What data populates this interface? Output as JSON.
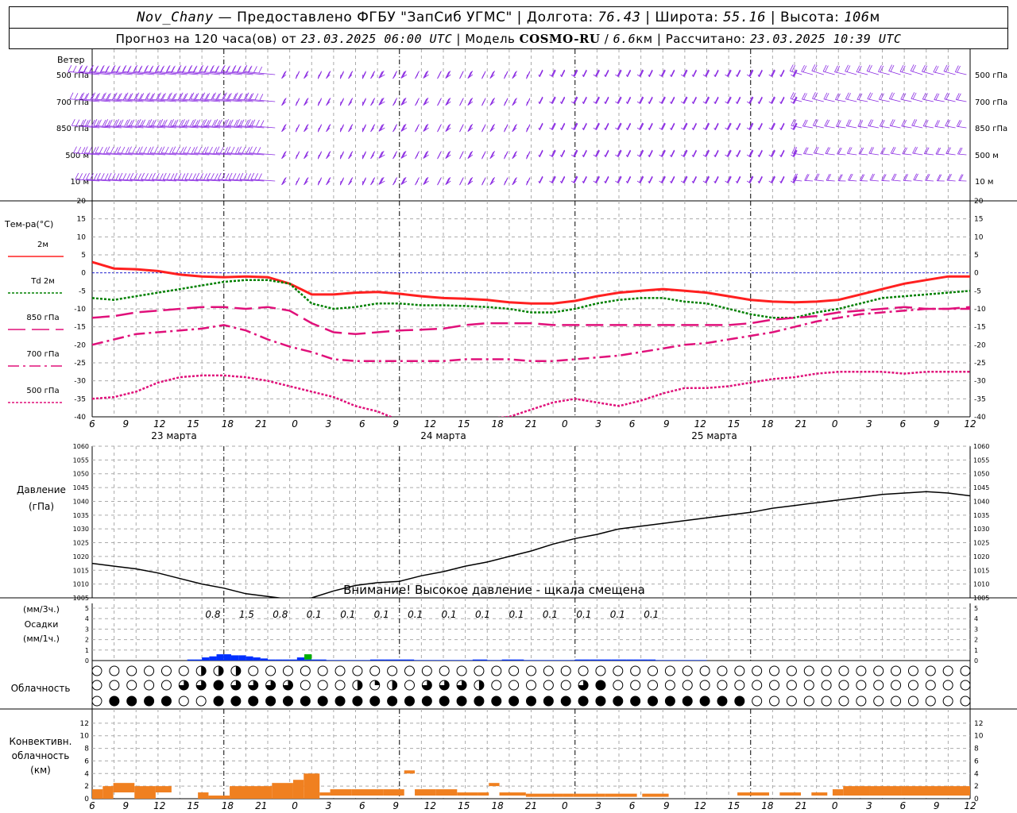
{
  "header": {
    "station": "Nov_Chany",
    "provider": "Предоставлено ФГБУ \"ЗапСиб УГМС\"",
    "lon_label": "Долгота:",
    "lon": "76.43",
    "lat_label": "Широта:",
    "lat": "55.16",
    "alt_label": "Высота:",
    "alt": "106",
    "alt_unit": "м",
    "forecast_label": "Прогноз на 120 часа(ов) от",
    "forecast_start": "23.03.2025 06:00 UTC",
    "model_label": "Модель",
    "model": "COSMO-RU",
    "model_res": "6.6",
    "model_res_unit": "км",
    "calc_label": "Рассчитано:",
    "calc_time": "23.03.2025 10:39 UTC"
  },
  "colors": {
    "wind": "#8a2be2",
    "t2m": "#ff2020",
    "td2m": "#008000",
    "t850": "#e0107a",
    "t700": "#e0107a",
    "t500": "#e0107a",
    "zero_line": "#0000cc",
    "pressure": "#000000",
    "precip3": "#0030ff",
    "precip_green": "#00b000",
    "convective": "#f08020",
    "grid": "#aaaaaa"
  },
  "chart_data": [
    {
      "type": "line",
      "panel": "temperature",
      "ylabel": "Тем-ра(°C)",
      "ylim": [
        -40,
        20
      ],
      "yticks": [
        20,
        15,
        10,
        5,
        0,
        -5,
        -10,
        -15,
        -20,
        -25,
        -30,
        -35,
        -40
      ],
      "x_hours": [
        0,
        3,
        6,
        9,
        12,
        15,
        18,
        21,
        24,
        27,
        30,
        33,
        36,
        39,
        42,
        45,
        48,
        51,
        54,
        57,
        60,
        63,
        66,
        69,
        72,
        75,
        78,
        81,
        84,
        87,
        90,
        93,
        96,
        99,
        102,
        105,
        108,
        111,
        114,
        117,
        120
      ],
      "xtick_labels": [
        "6",
        "9",
        "12",
        "15",
        "18",
        "21",
        "0",
        "3",
        "6",
        "9",
        "12",
        "15",
        "18",
        "21",
        "0",
        "3",
        "6",
        "9",
        "12",
        "15",
        "18",
        "21",
        "0",
        "3",
        "6",
        "9",
        "12"
      ],
      "date_labels": [
        "23 марта",
        "24 марта",
        "25 марта"
      ],
      "series": [
        {
          "name": "2м",
          "style": "solid",
          "values": [
            3,
            1.2,
            1,
            0.5,
            -0.5,
            -1,
            -1.2,
            -1,
            -1.2,
            -3,
            -6,
            -6,
            -5.5,
            -5.3,
            -5.8,
            -6.5,
            -7,
            -7.2,
            -7.5,
            -8.2,
            -8.5,
            -8.5,
            -7.8,
            -6.5,
            -5.5,
            -5,
            -4.5,
            -5,
            -5.5,
            -6.5,
            -7.5,
            -8,
            -8.2,
            -8,
            -7.5,
            -6,
            -4.5,
            -3,
            -2,
            -1,
            -1
          ]
        },
        {
          "name": "Td 2м",
          "style": "dotted",
          "values": [
            -7,
            -7.5,
            -6.5,
            -5.5,
            -4.5,
            -3.5,
            -2.5,
            -2,
            -2,
            -3,
            -8.5,
            -10,
            -9.5,
            -8.5,
            -8.5,
            -9,
            -9,
            -9.2,
            -9.5,
            -10,
            -11,
            -11,
            -10,
            -8.5,
            -7.5,
            -7,
            -7,
            -8,
            -8.5,
            -10,
            -11.5,
            -12.5,
            -12.5,
            -11,
            -10,
            -8.5,
            -7,
            -6.5,
            -6,
            -5.5,
            -5
          ]
        },
        {
          "name": "850 гПа",
          "style": "longdash",
          "values": [
            -12.5,
            -12,
            -11,
            -10.5,
            -10,
            -9.5,
            -9.5,
            -10,
            -9.5,
            -10.5,
            -14,
            -16.5,
            -17,
            -16.5,
            -16,
            -15.8,
            -15.5,
            -14.5,
            -14,
            -14,
            -14,
            -14.5,
            -14.5,
            -14.5,
            -14.5,
            -14.5,
            -14.5,
            -14.5,
            -14.5,
            -14.5,
            -14,
            -13,
            -12.5,
            -12,
            -11,
            -10.5,
            -10,
            -9.5,
            -10,
            -10,
            -9.5
          ]
        },
        {
          "name": "700 гПа",
          "style": "dashdot",
          "values": [
            -20,
            -18.5,
            -17,
            -16.5,
            -16,
            -15.5,
            -14.5,
            -16,
            -18.5,
            -20.5,
            -22,
            -24,
            -24.5,
            -24.5,
            -24.5,
            -24.5,
            -24.5,
            -24,
            -24,
            -24,
            -24.5,
            -24.5,
            -24,
            -23.5,
            -23,
            -22,
            -21,
            -20,
            -19.5,
            -18.5,
            -17.5,
            -16.5,
            -15,
            -13.5,
            -12.5,
            -11.5,
            -11,
            -10.5,
            -10,
            -10,
            -10
          ]
        },
        {
          "name": "500 гПа",
          "style": "dotted",
          "values": [
            -35,
            -34.5,
            -33,
            -30.5,
            -29,
            -28.5,
            -28.5,
            -29,
            -30,
            -31.5,
            -33,
            -34.5,
            -37,
            -38.5,
            -41,
            -43,
            -43,
            -42,
            -40.5,
            -40,
            -38,
            -36,
            -35,
            -36,
            -37,
            -35.5,
            -33.5,
            -32,
            -32,
            -31.5,
            -30.5,
            -29.5,
            -29,
            -28,
            -27.5,
            -27.5,
            -27.5,
            -28,
            -27.5,
            -27.5,
            -27.5
          ]
        }
      ]
    },
    {
      "type": "line",
      "panel": "pressure",
      "ylabel": "Давление",
      "yunit": "(гПа)",
      "ylim": [
        1005,
        1060
      ],
      "yticks": [
        1060,
        1055,
        1050,
        1045,
        1040,
        1035,
        1030,
        1025,
        1020,
        1015,
        1010,
        1005
      ],
      "annotation": "Внимание! Высокое давление - щкала смещена",
      "series": [
        {
          "values": [
            1017.5,
            1016.5,
            1015.5,
            1014,
            1012,
            1010,
            1008.5,
            1006.5,
            1005.5,
            1004.5,
            1005,
            1007.5,
            1009.5,
            1010.5,
            1011,
            1013,
            1014.5,
            1016.5,
            1018,
            1020,
            1022,
            1024.5,
            1026.5,
            1028,
            1030,
            1031,
            1032,
            1033,
            1034,
            1035,
            1036,
            1037.5,
            1038.5,
            1039.5,
            1040.5,
            1041.5,
            1042.5,
            1043,
            1043.5,
            1043,
            1042
          ]
        }
      ]
    },
    {
      "type": "bar",
      "panel": "precipitation",
      "ylabel": "Осадки",
      "yunit_top": "(мм/3ч.)",
      "yunit_bottom": "(мм/1ч.)",
      "ylim": [
        0,
        5
      ],
      "yticks": [
        5,
        4,
        3,
        2,
        1,
        0
      ],
      "totals_3h": [
        "0.8",
        "1.5",
        "0.8",
        "0.1",
        "0.1",
        "0.1",
        "0.1",
        "0.1",
        "0.1",
        "0.1",
        "0.1",
        "0.1",
        "0.1",
        "0.1"
      ],
      "hourly": [
        0,
        0,
        0,
        0,
        0,
        0,
        0,
        0,
        0,
        0,
        0,
        0,
        0,
        0.1,
        0.1,
        0.3,
        0.4,
        0.6,
        0.6,
        0.5,
        0.5,
        0.4,
        0.3,
        0.2,
        0.1,
        0.1,
        0.1,
        0.1,
        0.3,
        0.1,
        0.1,
        0.1,
        0.05,
        0.05,
        0.05,
        0.05,
        0.05,
        0.05,
        0.1,
        0.1,
        0.1,
        0.1,
        0.1,
        0.1,
        0.05,
        0.05,
        0.05,
        0.05,
        0.05,
        0.05,
        0.05,
        0.05,
        0.1,
        0.1,
        0.05,
        0.05,
        0.1,
        0.1,
        0.1,
        0.05,
        0.05,
        0.05,
        0.05,
        0.05,
        0.05,
        0.05,
        0.1,
        0.1,
        0.1,
        0.1,
        0.1,
        0.1,
        0.1,
        0.1,
        0.1,
        0.1,
        0.1,
        0.05,
        0.05,
        0.05,
        0.05,
        0.05,
        0.05,
        0.05,
        0,
        0,
        0,
        0,
        0,
        0,
        0,
        0,
        0,
        0,
        0,
        0,
        0,
        0,
        0,
        0,
        0,
        0,
        0,
        0,
        0,
        0,
        0,
        0,
        0,
        0,
        0,
        0,
        0,
        0,
        0,
        0,
        0,
        0,
        0,
        0
      ],
      "green_hours": [
        29
      ],
      "green_value": 0.5
    },
    {
      "type": "table",
      "panel": "cloudiness",
      "ylabel": "Облачность",
      "rows": [
        "000000000000012222210000000000000000000000000000000000000000000000000000000000000000000000000000000000000000000000000000",
        "000000000023333443333333333000000002211220023333333222000000000023344300000000000000000000000000000000000000000000000000",
        "044444444440000444444444444444444444444444444444444444444444444444444444444444444444440000000100010000000000000000000"
      ]
    },
    {
      "type": "bar",
      "panel": "convective",
      "ylabel_lines": [
        "Конвективн.",
        "облачность",
        "(км)"
      ],
      "ylim": [
        0,
        14
      ],
      "yticks": [
        12,
        10,
        8,
        6,
        4,
        2,
        0
      ],
      "segments": [
        {
          "h0": 0,
          "h1": 2,
          "base": 0,
          "top": 1.5
        },
        {
          "h0": 2,
          "h1": 4,
          "base": 0,
          "top": 2
        },
        {
          "h0": 4,
          "h1": 8,
          "base": 1,
          "top": 2.5
        },
        {
          "h0": 8,
          "h1": 12,
          "base": 0,
          "top": 2
        },
        {
          "h0": 12,
          "h1": 15,
          "base": 1,
          "top": 2
        },
        {
          "h0": 20,
          "h1": 22,
          "base": 0,
          "top": 1
        },
        {
          "h0": 22,
          "h1": 26,
          "base": 0,
          "top": 0.5
        },
        {
          "h0": 26,
          "h1": 34,
          "base": 0,
          "top": 2
        },
        {
          "h0": 34,
          "h1": 38,
          "base": 0,
          "top": 2.5
        },
        {
          "h0": 38,
          "h1": 40,
          "base": 0,
          "top": 3
        },
        {
          "h0": 40,
          "h1": 43,
          "base": 0,
          "top": 4
        },
        {
          "h0": 43,
          "h1": 45,
          "base": 0.5,
          "top": 1
        },
        {
          "h0": 45,
          "h1": 49,
          "base": 0.5,
          "top": 1.5
        },
        {
          "h0": 49,
          "h1": 55,
          "base": 0.5,
          "top": 1.5
        },
        {
          "h0": 55,
          "h1": 59,
          "base": 0.5,
          "top": 1.5
        },
        {
          "h0": 59,
          "h1": 61,
          "base": 4,
          "top": 4.5
        },
        {
          "h0": 61,
          "h1": 65,
          "base": 0.5,
          "top": 1.5
        },
        {
          "h0": 65,
          "h1": 69,
          "base": 0.5,
          "top": 1.5
        },
        {
          "h0": 69,
          "h1": 73,
          "base": 0.5,
          "top": 1
        },
        {
          "h0": 73,
          "h1": 75,
          "base": 0.5,
          "top": 1
        },
        {
          "h0": 75,
          "h1": 77,
          "base": 2,
          "top": 2.5
        },
        {
          "h0": 77,
          "h1": 82,
          "base": 0.5,
          "top": 1
        },
        {
          "h0": 82,
          "h1": 89,
          "base": 0.3,
          "top": 0.8
        },
        {
          "h0": 89,
          "h1": 91,
          "base": 0.3,
          "top": 0.8
        },
        {
          "h0": 91,
          "h1": 97,
          "base": 0.3,
          "top": 0.8
        },
        {
          "h0": 97,
          "h1": 103,
          "base": 0.3,
          "top": 0.8
        },
        {
          "h0": 104,
          "h1": 109,
          "base": 0.3,
          "top": 0.8
        },
        {
          "h0": 122,
          "h1": 128,
          "base": 0.5,
          "top": 1
        },
        {
          "h0": 130,
          "h1": 134,
          "base": 0.5,
          "top": 1
        },
        {
          "h0": 136,
          "h1": 139,
          "base": 0.5,
          "top": 1
        },
        {
          "h0": 140,
          "h1": 142,
          "base": 0.5,
          "top": 1.5
        },
        {
          "h0": 142,
          "h1": 147,
          "base": 0.5,
          "top": 2
        },
        {
          "h0": 147,
          "h1": 153,
          "base": 0.5,
          "top": 2
        },
        {
          "h0": 153,
          "h1": 166,
          "base": 0.5,
          "top": 2
        }
      ]
    },
    {
      "type": "scatter",
      "panel": "wind",
      "ylabel": "Ветер",
      "levels": [
        "500 гПа",
        "700 гПа",
        "850 гПа",
        "500 м",
        "10  м"
      ]
    }
  ]
}
